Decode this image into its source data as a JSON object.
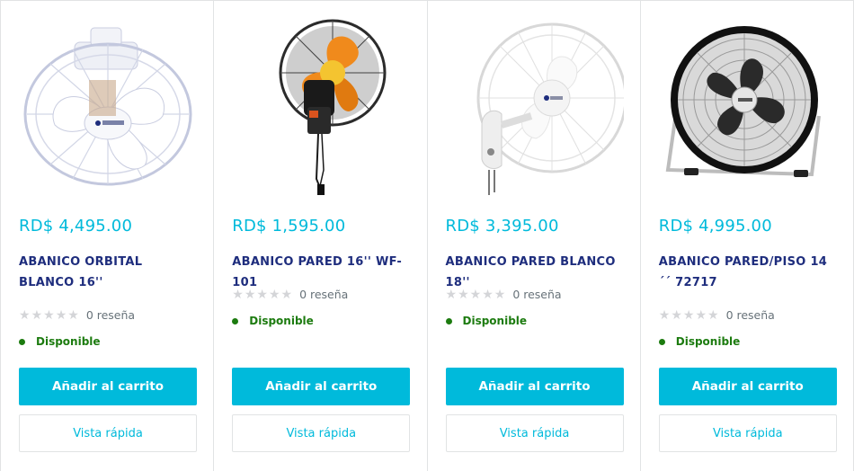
{
  "colors": {
    "accent": "#00badb",
    "title": "#1e2d7d",
    "in_stock": "#1c7b0f",
    "star_empty": "#d4d5d8"
  },
  "products": [
    {
      "image": "orbital-ceiling-fan-image",
      "price": "RD$ 4,495.00",
      "title": "ABANICO ORBITAL BLANCO 16''",
      "rating": 0,
      "reviews": "0 reseña",
      "stock": "Disponible",
      "add_to_cart": "Añadir al carrito",
      "quick_view": "Vista rápida"
    },
    {
      "image": "wall-fan-black-orange-image",
      "price": "RD$ 1,595.00",
      "title": "ABANICO PARED 16'' WF-101",
      "rating": 0,
      "reviews": "0 reseña",
      "stock": "Disponible",
      "add_to_cart": "Añadir al carrito",
      "quick_view": "Vista rápida"
    },
    {
      "image": "wall-fan-white-image",
      "price": "RD$ 3,395.00",
      "title": "ABANICO PARED BLANCO 18''",
      "rating": 0,
      "reviews": "0 reseña",
      "stock": "Disponible",
      "add_to_cart": "Añadir al carrito",
      "quick_view": "Vista rápida"
    },
    {
      "image": "floor-fan-black-image",
      "price": "RD$ 4,995.00",
      "title": "ABANICO PARED/PISO 14´´ 72717",
      "rating": 0,
      "reviews": "0 reseña",
      "stock": "Disponible",
      "add_to_cart": "Añadir al carrito",
      "quick_view": "Vista rápida"
    }
  ]
}
